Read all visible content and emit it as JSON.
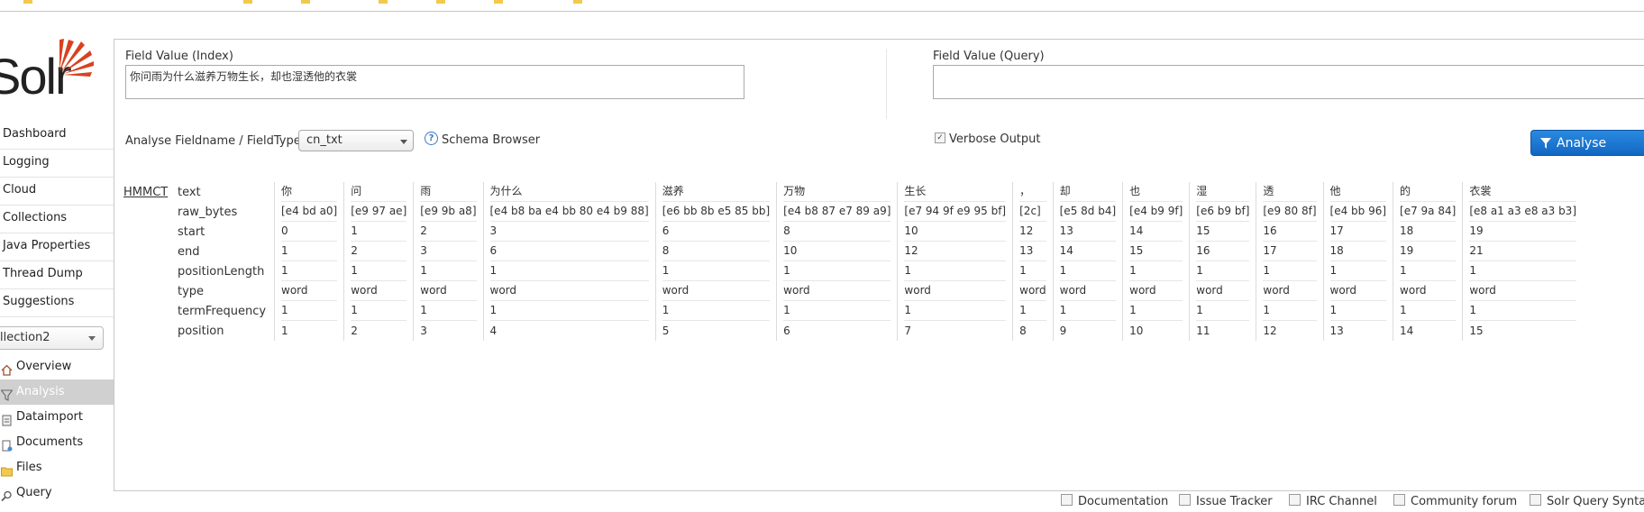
{
  "logo": {
    "text": "Solr",
    "accent_color": "#d9411e"
  },
  "nav": {
    "items": [
      "Dashboard",
      "Logging",
      "Cloud",
      "Collections",
      "Java Properties",
      "Thread Dump",
      "Suggestions"
    ],
    "core_selector": "llection2",
    "core_items": [
      {
        "label": "Overview",
        "icon": "home-icon"
      },
      {
        "label": "Analysis",
        "icon": "filter-icon",
        "active": true
      },
      {
        "label": "Dataimport",
        "icon": "dataimport-icon"
      },
      {
        "label": "Documents",
        "icon": "documents-icon"
      },
      {
        "label": "Files",
        "icon": "folder-icon"
      },
      {
        "label": "Query",
        "icon": "search-icon"
      }
    ]
  },
  "analysis": {
    "index_label": "Field Value (Index)",
    "index_value": "你问雨为什么滋养万物生长，却也湿透他的衣裳",
    "query_label": "Field Value (Query)",
    "query_value": "",
    "fieldtype_label": "Analyse Fieldname / FieldType:",
    "fieldtype_value": "cn_txt",
    "schema_browser": "Schema Browser",
    "verbose_label": "Verbose Output",
    "verbose_checked": true,
    "analyse_button": "Analyse Values",
    "button_color": "#1a74d0"
  },
  "table": {
    "stage": "HMMCT",
    "attributes": [
      "text",
      "raw_bytes",
      "start",
      "end",
      "positionLength",
      "type",
      "termFrequency",
      "position"
    ],
    "tokens": [
      [
        "你",
        "[e4 bd a0]",
        "0",
        "1",
        "1",
        "word",
        "1",
        "1"
      ],
      [
        "问",
        "[e9 97 ae]",
        "1",
        "2",
        "1",
        "word",
        "1",
        "2"
      ],
      [
        "雨",
        "[e9 9b a8]",
        "2",
        "3",
        "1",
        "word",
        "1",
        "3"
      ],
      [
        "为什么",
        "[e4 b8 ba e4 bb 80 e4 b9 88]",
        "3",
        "6",
        "1",
        "word",
        "1",
        "4"
      ],
      [
        "滋养",
        "[e6 bb 8b e5 85 bb]",
        "6",
        "8",
        "1",
        "word",
        "1",
        "5"
      ],
      [
        "万物",
        "[e4 b8 87 e7 89 a9]",
        "8",
        "10",
        "1",
        "word",
        "1",
        "6"
      ],
      [
        "生长",
        "[e7 94 9f e9 95 bf]",
        "10",
        "12",
        "1",
        "word",
        "1",
        "7"
      ],
      [
        "，",
        "[2c]",
        "12",
        "13",
        "1",
        "word",
        "1",
        "8"
      ],
      [
        "却",
        "[e5 8d b4]",
        "13",
        "14",
        "1",
        "word",
        "1",
        "9"
      ],
      [
        "也",
        "[e4 b9 9f]",
        "14",
        "15",
        "1",
        "word",
        "1",
        "10"
      ],
      [
        "湿",
        "[e6 b9 bf]",
        "15",
        "16",
        "1",
        "word",
        "1",
        "11"
      ],
      [
        "透",
        "[e9 80 8f]",
        "16",
        "17",
        "1",
        "word",
        "1",
        "12"
      ],
      [
        "他",
        "[e4 bb 96]",
        "17",
        "18",
        "1",
        "word",
        "1",
        "13"
      ],
      [
        "的",
        "[e7 9a 84]",
        "18",
        "19",
        "1",
        "word",
        "1",
        "14"
      ],
      [
        "衣裳",
        "[e8 a1 a3 e8 a3 b3]",
        "19",
        "21",
        "1",
        "word",
        "1",
        "15"
      ]
    ]
  },
  "footer": {
    "items": [
      {
        "label": "Documentation",
        "icon": "documentation-icon"
      },
      {
        "label": "Issue Tracker",
        "icon": "bug-icon"
      },
      {
        "label": "IRC Channel",
        "icon": "irc-icon"
      },
      {
        "label": "Community forum",
        "icon": "mail-icon"
      },
      {
        "label": "Solr Query Syntax",
        "icon": "query-syntax-icon"
      }
    ]
  }
}
